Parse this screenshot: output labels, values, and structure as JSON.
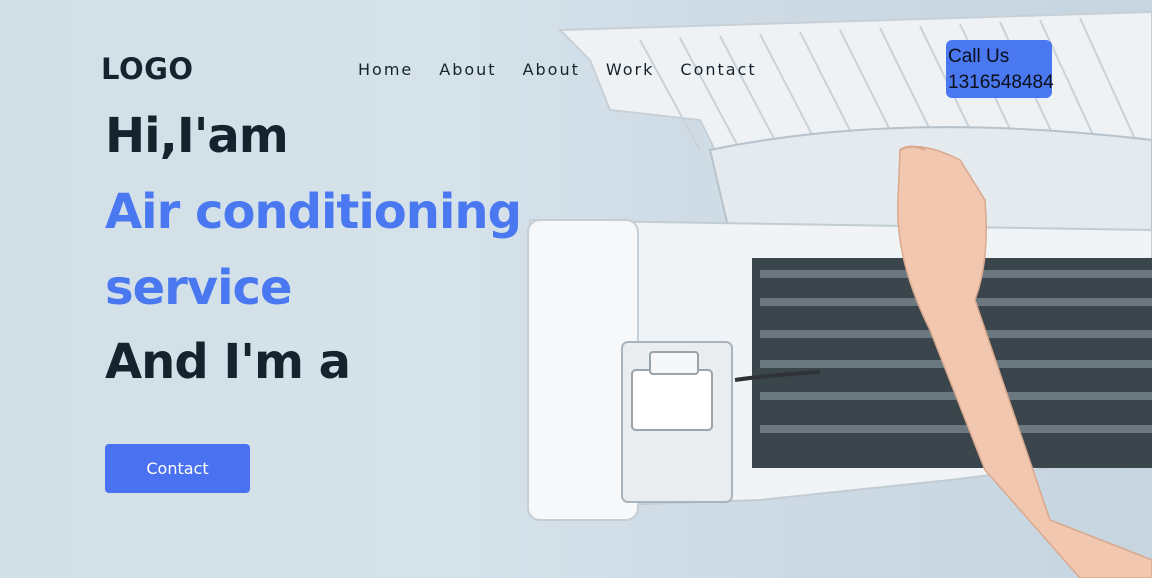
{
  "header": {
    "logo": "LOGO",
    "nav": [
      "Home",
      "About",
      "About",
      "Work",
      "Contact"
    ],
    "call_us": "Call Us",
    "phone": "1316548484"
  },
  "hero": {
    "line1": "Hi,I'am",
    "line2": "Air conditioning",
    "line3": "service",
    "line4": "And I'm a",
    "cta": "Contact"
  },
  "colors": {
    "accent": "#4a78f0",
    "text_dark": "#14232d",
    "background": "#d5e0e8"
  }
}
